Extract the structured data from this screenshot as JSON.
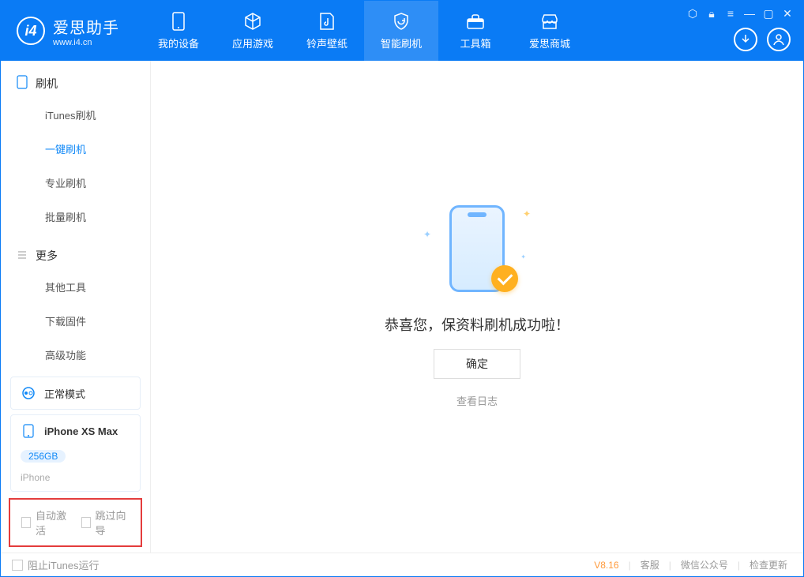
{
  "brand": {
    "title": "爱思助手",
    "subtitle": "www.i4.cn"
  },
  "nav": {
    "items": [
      {
        "label": "我的设备"
      },
      {
        "label": "应用游戏"
      },
      {
        "label": "铃声壁纸"
      },
      {
        "label": "智能刷机"
      },
      {
        "label": "工具箱"
      },
      {
        "label": "爱思商城"
      }
    ]
  },
  "sidebar": {
    "section1": {
      "title": "刷机",
      "items": [
        "iTunes刷机",
        "一键刷机",
        "专业刷机",
        "批量刷机"
      ]
    },
    "section2": {
      "title": "更多",
      "items": [
        "其他工具",
        "下载固件",
        "高级功能"
      ]
    },
    "mode": "正常模式",
    "device": {
      "name": "iPhone XS Max",
      "storage": "256GB",
      "type": "iPhone"
    },
    "checks": {
      "auto_activate": "自动激活",
      "skip_guide": "跳过向导"
    }
  },
  "main": {
    "success_text": "恭喜您，保资料刷机成功啦！",
    "confirm": "确定",
    "view_log": "查看日志"
  },
  "footer": {
    "block_itunes": "阻止iTunes运行",
    "version": "V8.16",
    "links": [
      "客服",
      "微信公众号",
      "检查更新"
    ]
  }
}
